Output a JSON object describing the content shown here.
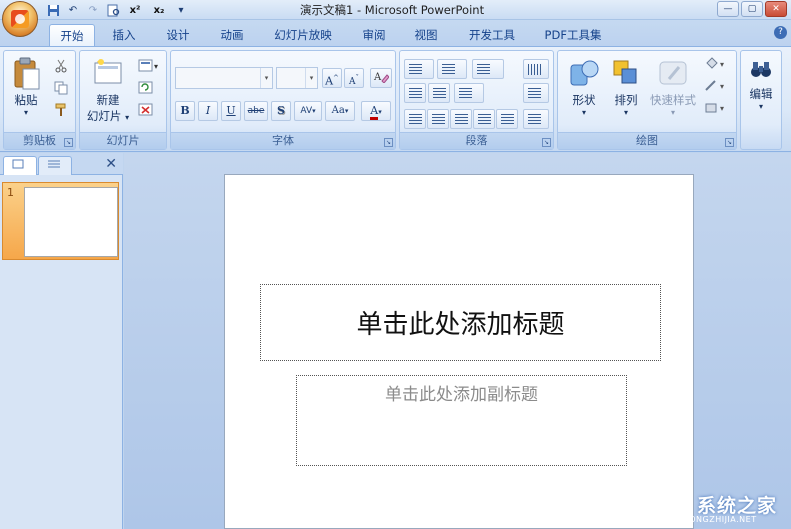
{
  "titlebar": {
    "title": "演示文稿1 - Microsoft PowerPoint",
    "qat": [
      "save-icon",
      "undo-icon",
      "redo-icon",
      "print-preview-icon",
      "superscript-icon",
      "subscript-icon",
      "customize-qat-icon"
    ],
    "superscript_label": "x²",
    "subscript_label": "x₂"
  },
  "tabs": [
    "开始",
    "插入",
    "设计",
    "动画",
    "幻灯片放映",
    "审阅",
    "视图",
    "开发工具",
    "PDF工具集"
  ],
  "active_tab": "开始",
  "ribbon": {
    "clipboard": {
      "label": "剪贴板",
      "paste": "粘贴"
    },
    "slides": {
      "label": "幻灯片",
      "new_slide_line1": "新建",
      "new_slide_line2": "幻灯片"
    },
    "font": {
      "label": "字体",
      "font_name": "",
      "font_size": "",
      "bold": "B",
      "italic": "I",
      "underline": "U",
      "strike": "abe",
      "shadow": "S",
      "spacing": "AV",
      "case": "Aa",
      "color": "A",
      "grow": "A",
      "shrink": "A"
    },
    "paragraph": {
      "label": "段落"
    },
    "drawing": {
      "label": "绘图",
      "shapes": "形状",
      "arrange": "排列",
      "quick_styles": "快速样式"
    },
    "editing": {
      "label": "编辑"
    }
  },
  "slide": {
    "number": "1",
    "title_placeholder": "单击此处添加标题",
    "subtitle_placeholder": "单击此处添加副标题"
  },
  "watermark": {
    "text": "系统之家",
    "sub": "XITONGZHIJIA.NET"
  },
  "colors": {
    "accent": "#15428b",
    "thumb_highlight": "#f6a74a",
    "workspace": "#bcd2ef"
  }
}
